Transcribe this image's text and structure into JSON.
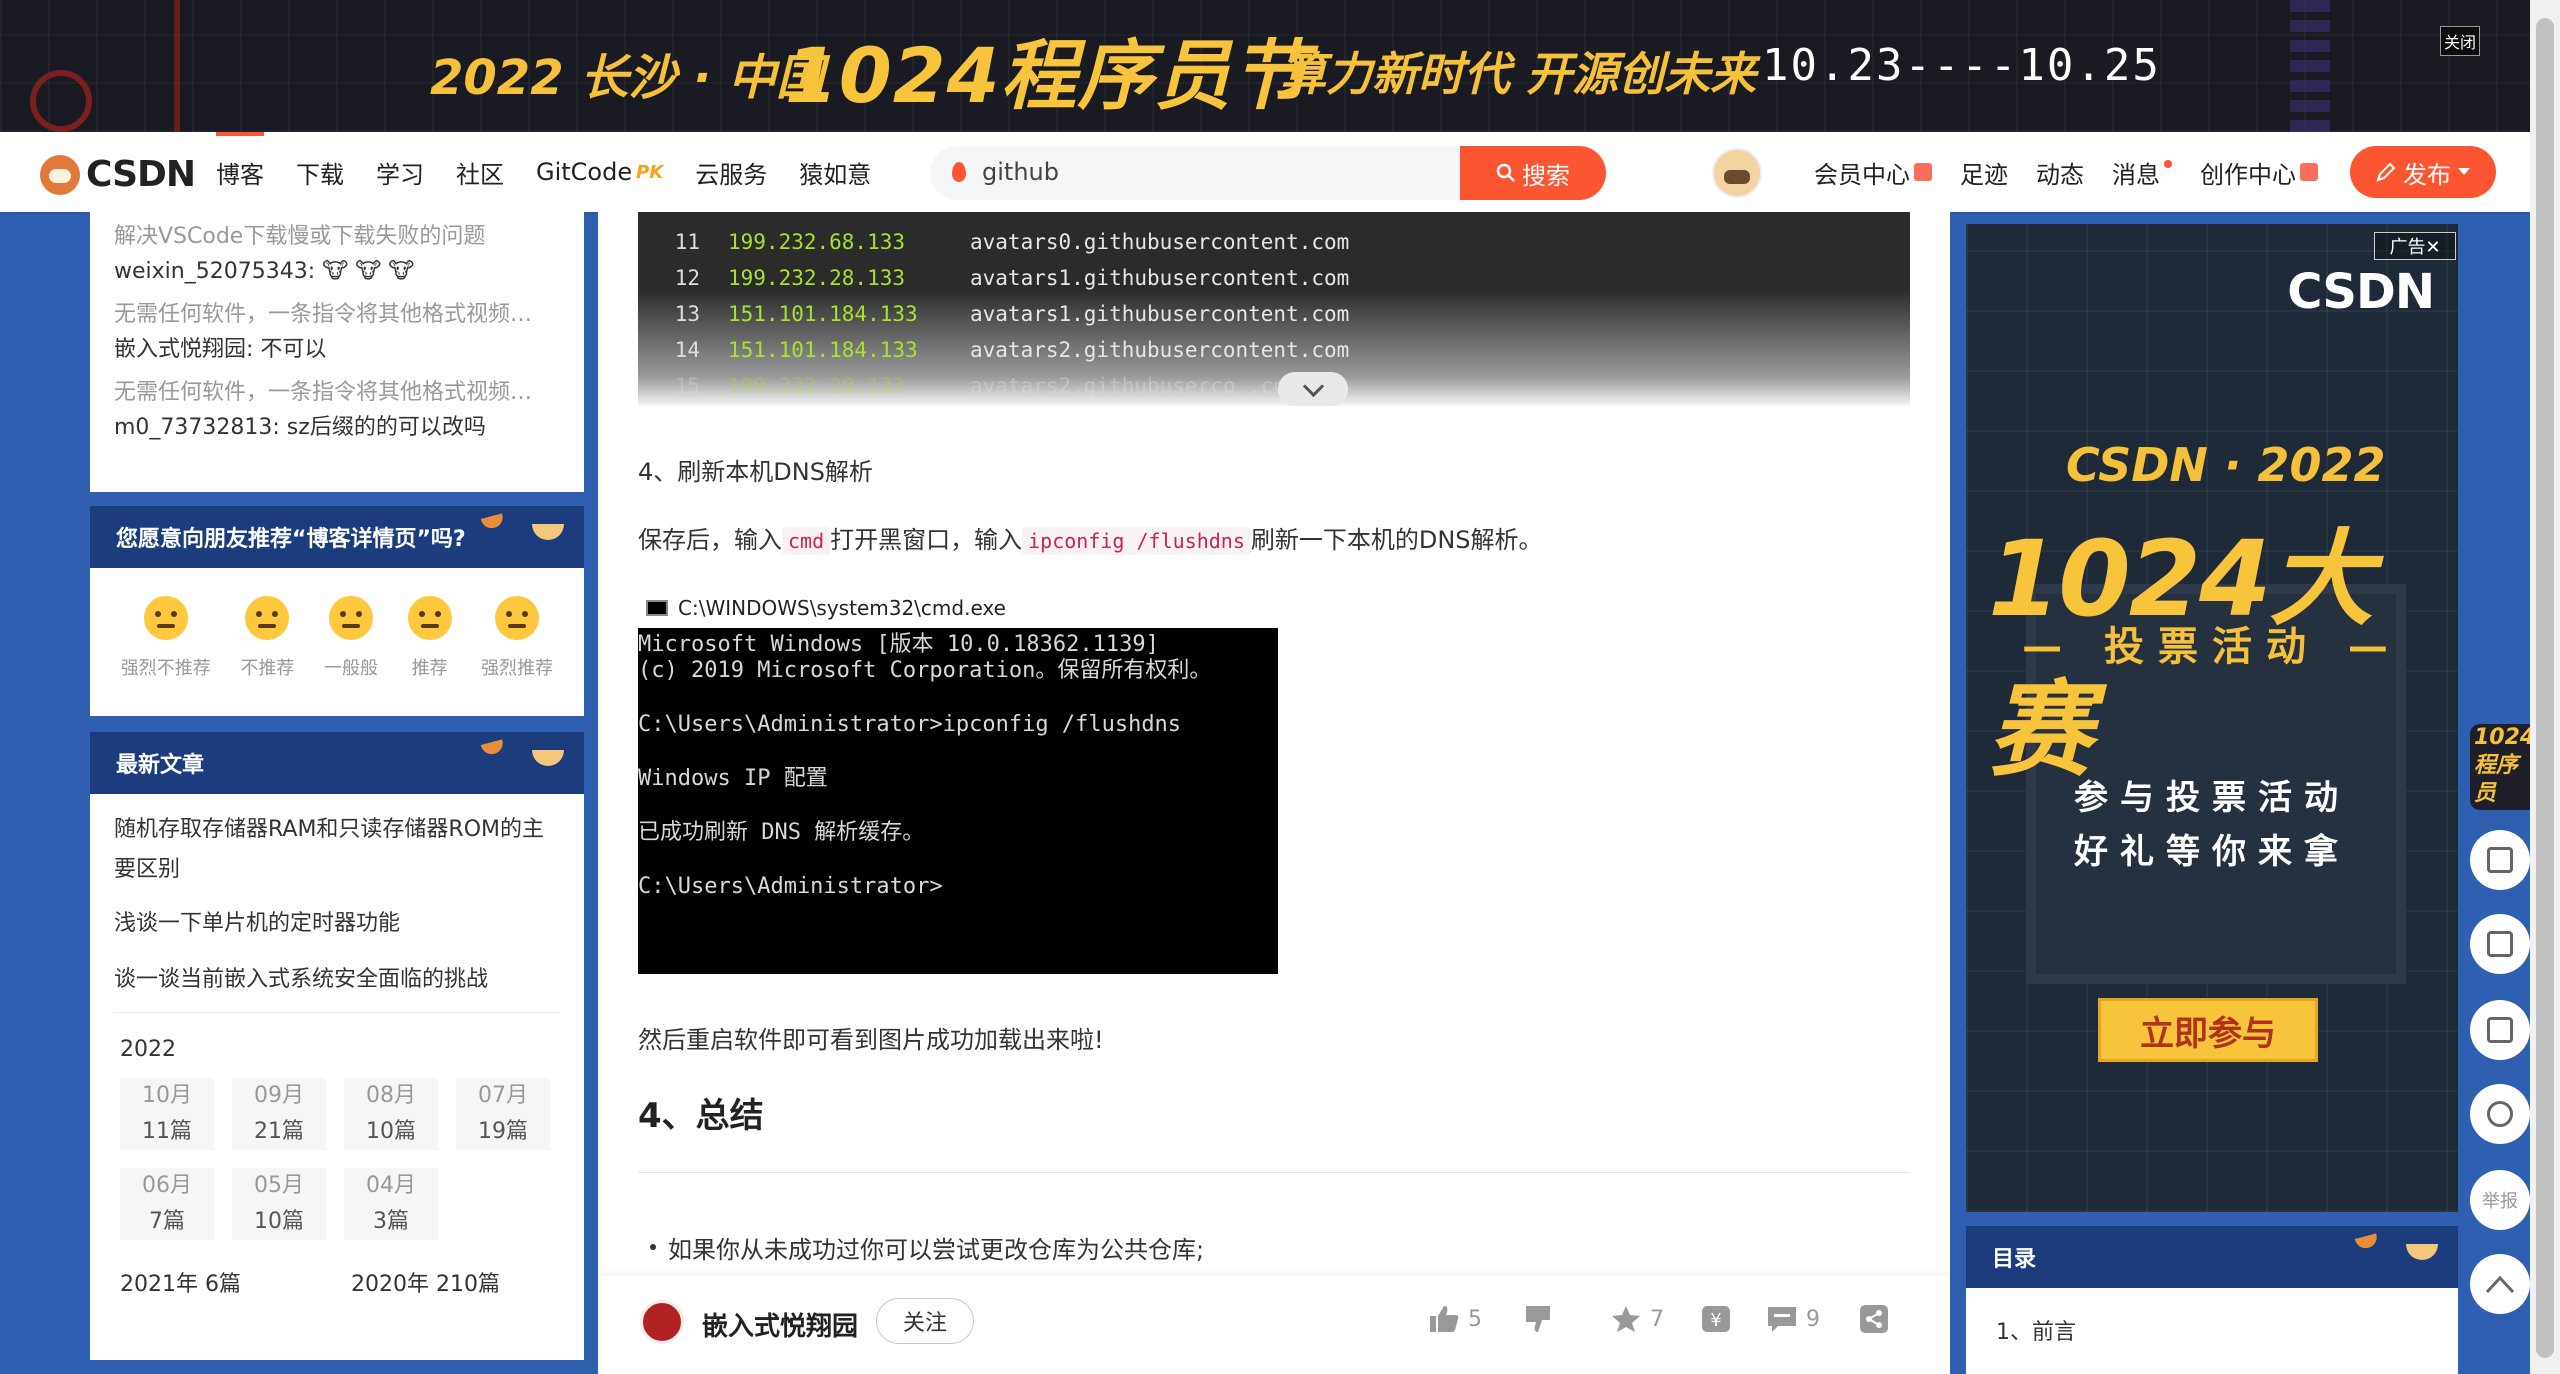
{
  "banner": {
    "line1": "2022 长沙 · 中国",
    "line2": "1024程序员节",
    "line3": "算力新时代 开源创未来",
    "dates": "10.23----10.25",
    "close": "关闭"
  },
  "nav": {
    "logo": "CSDN",
    "items": [
      "博客",
      "下载",
      "学习",
      "社区",
      "GitCode",
      "云服务",
      "猿如意"
    ],
    "gitcode_pk": "PK",
    "search_value": "github",
    "search_button": "搜索",
    "right_items": [
      "会员中心",
      "足迹",
      "动态",
      "消息",
      "创作中心"
    ],
    "publish": "发布"
  },
  "sidebar": {
    "comments": [
      {
        "q": "解决VSCode下载慢或下载失败的问题",
        "a": "weixin_52075343: 🐮 🐮 🐮"
      },
      {
        "q": "无需任何软件，一条指令将其他格式视频…",
        "a": "嵌入式悦翔园: 不可以"
      },
      {
        "q": "无需任何软件，一条指令将其他格式视频…",
        "a": "m0_73732813: sz后缀的的可以改吗"
      }
    ],
    "rate_title": "您愿意向朋友推荐“博客详情页”吗?",
    "rates": [
      "强烈不推荐",
      "不推荐",
      "一般般",
      "推荐",
      "强烈推荐"
    ],
    "new_title": "最新文章",
    "articles": [
      "随机存取存储器RAM和只读存储器ROM的主要区别",
      "浅谈一下单片机的定时器功能",
      "谈一谈当前嵌入式系统安全面临的挑战"
    ],
    "archive_year": "2022",
    "months": [
      {
        "m": "10月",
        "c": "11篇"
      },
      {
        "m": "09月",
        "c": "21篇"
      },
      {
        "m": "08月",
        "c": "10篇"
      },
      {
        "m": "07月",
        "c": "19篇"
      },
      {
        "m": "06月",
        "c": "7篇"
      },
      {
        "m": "05月",
        "c": "10篇"
      },
      {
        "m": "04月",
        "c": "3篇"
      }
    ],
    "other_years": [
      "2021年 6篇",
      "2020年 210篇"
    ]
  },
  "article": {
    "code_lines": [
      {
        "no": "11",
        "ip": "199.232.68.133",
        "host": "avatars0.githubusercontent.com"
      },
      {
        "no": "12",
        "ip": "199.232.28.133",
        "host": "avatars1.githubusercontent.com"
      },
      {
        "no": "13",
        "ip": "151.101.184.133",
        "host": "avatars1.githubusercontent.com"
      },
      {
        "no": "14",
        "ip": "151.101.184.133",
        "host": "avatars2.githubusercontent.com"
      },
      {
        "no": "15",
        "ip": "199.232.28.133",
        "host": "avatars2.githubuserco     .com"
      }
    ],
    "step_heading": "4、刷新本机DNS解析",
    "para_a": "保存后，输入",
    "code_cmd": "cmd",
    "para_b": "打开黑窗口，输入",
    "code_flush": "ipconfig /flushdns",
    "para_c": "刷新一下本机的DNS解析。",
    "cmd_title": "C:\\WINDOWS\\system32\\cmd.exe",
    "cmd_lines": [
      "Microsoft Windows [版本 10.0.18362.1139]",
      "(c) 2019 Microsoft Corporation。保留所有权利。",
      "",
      "C:\\Users\\Administrator>ipconfig /flushdns",
      "",
      "Windows IP 配置",
      "",
      "已成功刷新 DNS 解析缓存。",
      "",
      "C:\\Users\\Administrator>"
    ],
    "after_text": "然后重启软件即可看到图片成功加载出来啦!",
    "h2": "4、总结",
    "bullet": "如果你从未成功过你可以尝试更改仓库为公共仓库;"
  },
  "toolbar": {
    "author": "嵌入式悦翔园",
    "follow": "关注",
    "likes": "5",
    "stars": "7",
    "comments": "9"
  },
  "ad": {
    "tag": "广告✕",
    "brand": "CSDN",
    "l1": "CSDN · 2022",
    "l2": "1024大赛",
    "l3": "— 投票活动 —",
    "l4": "参与投票活动",
    "l5": "好礼等你来拿",
    "cta": "立即参与"
  },
  "toc": {
    "title": "目录",
    "first": "1、前言"
  },
  "side": {
    "promo": "1024 程序员",
    "report": "举报"
  }
}
